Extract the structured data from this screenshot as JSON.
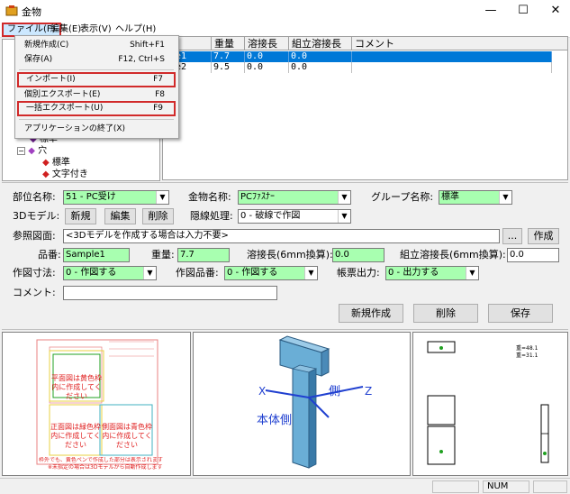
{
  "window": {
    "title": "金物",
    "minimize": "—",
    "maximize": "☐",
    "close": "✕"
  },
  "menubar": {
    "file": "ファイル(F)",
    "edit": "編集(E)",
    "view": "表示(V)",
    "help": "ヘルプ(H)"
  },
  "file_menu": {
    "items": [
      {
        "label": "新規作成(C)",
        "shortcut": "Shift+F1"
      },
      {
        "label": "保存(A)",
        "shortcut": "F12, Ctrl+S"
      },
      {
        "label": "インポート(I)",
        "shortcut": "F7"
      },
      {
        "label": "個別エクスポート(E)",
        "shortcut": "F8"
      },
      {
        "label": "一括エクスポート(U)",
        "shortcut": "F9"
      },
      {
        "label": "アプリケーションの終了(X)",
        "shortcut": ""
      }
    ]
  },
  "tree": {
    "items": [
      {
        "label": "標準"
      },
      {
        "label": "穴"
      },
      {
        "label": "標準"
      },
      {
        "label": "文字付き"
      }
    ]
  },
  "grid": {
    "headers": [
      "番",
      "重量",
      "溶接長",
      "組立溶接長",
      "コメント"
    ],
    "rows": [
      {
        "name": "ple1",
        "weight": "7.7",
        "weld": "0.0",
        "assembly": "0.0",
        "comment": ""
      },
      {
        "name": "ple2",
        "weight": "9.5",
        "weld": "0.0",
        "assembly": "0.0",
        "comment": ""
      }
    ]
  },
  "form": {
    "part_name_label": "部位名称:",
    "part_name_value": "51 - PC受け",
    "hardware_name_label": "金物名称:",
    "hardware_name_value": "PCﾌｧｽﾅｰ",
    "group_name_label": "グループ名称:",
    "group_name_value": "標準",
    "model3d_label": "3Dモデル:",
    "btn_new": "新規",
    "btn_edit": "編集",
    "btn_delete": "削除",
    "hidden_line_label": "隠線処理:",
    "hidden_line_value": "0 - 破線で作図",
    "ref_drawing_label": "参照図面:",
    "ref_drawing_value": "<3Dモデルを作成する場合は入力不要>",
    "btn_browse": "...",
    "btn_create": "作成",
    "part_number_label": "品番:",
    "part_number_value": "Sample1",
    "weight_label": "重量:",
    "weight_value": "7.7",
    "weld_length_label": "溶接長(6mm換算):",
    "weld_length_value": "0.0",
    "assembly_weld_label": "組立溶接長(6mm換算):",
    "assembly_weld_value": "0.0",
    "dim_label": "作図寸法:",
    "dim_value": "0 - 作図する",
    "drawing_part_label": "作図品番:",
    "drawing_part_value": "0 - 作図する",
    "report_label": "帳票出力:",
    "report_value": "0 - 出力する",
    "comment_label": "コメント:",
    "comment_value": "",
    "btn_new_create": "新規作成",
    "btn_remove": "削除",
    "btn_save": "保存"
  },
  "preview": {
    "front_text1": "平面図は黄色枠内に作成してください",
    "front_text2": "正面図は緑色枠内に作成してください",
    "front_text3": "側面図は青色枠内に作成してください",
    "front_note1": "枠外でも、黄色ペンで作成した部分は表示されます",
    "front_note2": "※未指定の場合は3Dモデルから自動作成します",
    "axis_x": "X",
    "axis_z": "Z",
    "label_body": "本体側",
    "label_side": "側",
    "weight_note1": "重=48.1",
    "weight_note2": "重=31.1"
  },
  "statusbar": {
    "num": "NUM"
  },
  "colors": {
    "selection": "#0078d7",
    "highlight_border": "#d12a2a",
    "field_green": "#a8ffb0",
    "model_blue": "#5a9fc9"
  }
}
